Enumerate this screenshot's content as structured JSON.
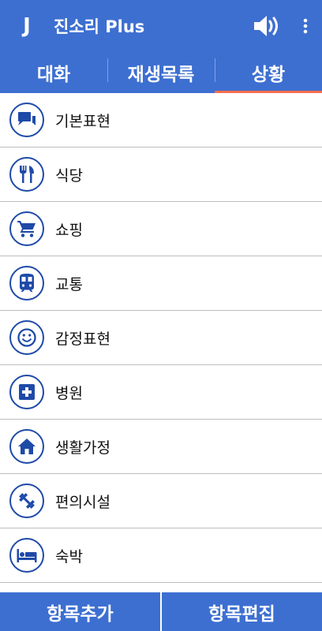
{
  "app": {
    "title": "진소리 Plus",
    "logo_letter": "J"
  },
  "icons": {
    "speaker": "speaker-icon",
    "more": "more-vertical-icon"
  },
  "tabs": [
    {
      "label": "대화",
      "active": false
    },
    {
      "label": "재생목록",
      "active": false
    },
    {
      "label": "상황",
      "active": true
    }
  ],
  "categories": [
    {
      "label": "기본표현",
      "icon": "chat-bubbles-icon"
    },
    {
      "label": "식당",
      "icon": "fork-knife-icon"
    },
    {
      "label": "쇼핑",
      "icon": "shopping-cart-icon"
    },
    {
      "label": "교통",
      "icon": "train-icon"
    },
    {
      "label": "감정표현",
      "icon": "smiley-icon"
    },
    {
      "label": "병원",
      "icon": "medical-cross-icon"
    },
    {
      "label": "생활가정",
      "icon": "home-icon"
    },
    {
      "label": "편의시설",
      "icon": "dumbbell-icon"
    },
    {
      "label": "숙박",
      "icon": "bed-icon"
    }
  ],
  "actions": {
    "add": "항목추가",
    "edit": "항목편집"
  },
  "colors": {
    "primary": "#3d6fd1",
    "icon": "#1e4aa8",
    "tab_indicator": "#ff6e4a"
  }
}
